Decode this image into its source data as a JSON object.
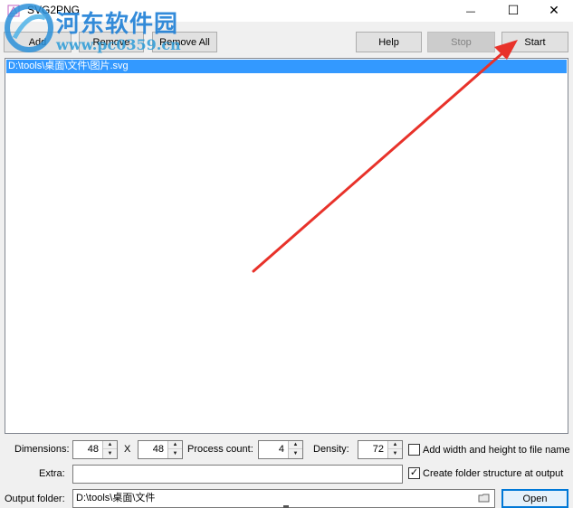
{
  "window": {
    "title": "SVG2PNG",
    "minimize_glyph": "—",
    "maximize_glyph": "☐",
    "close_glyph": "✕"
  },
  "toolbar": {
    "add_label": "Add",
    "remove_label": "Remove",
    "remove_all_label": "Remove All",
    "help_label": "Help",
    "stop_label": "Stop",
    "start_label": "Start"
  },
  "file_list": {
    "items": [
      "D:\\tools\\桌面\\文件\\图片.svg"
    ]
  },
  "options": {
    "dimensions_label": "Dimensions:",
    "width": "48",
    "x_label": "X",
    "height": "48",
    "process_count_label": "Process count:",
    "process_count": "4",
    "density_label": "Density:",
    "density": "72",
    "add_wh_label": "Add width and height to file name",
    "add_wh_checked": false,
    "extra_label": "Extra:",
    "extra_value": "",
    "create_folder_label": "Create folder structure at output",
    "create_folder_checked": true,
    "output_folder_label": "Output folder:",
    "output_folder_value": "D:\\tools\\桌面\\文件",
    "open_label": "Open"
  },
  "watermark": {
    "text": "河东软件园",
    "url": "www.pc0359.cn"
  },
  "annotation": {
    "arrow_color": "#e8322a"
  }
}
